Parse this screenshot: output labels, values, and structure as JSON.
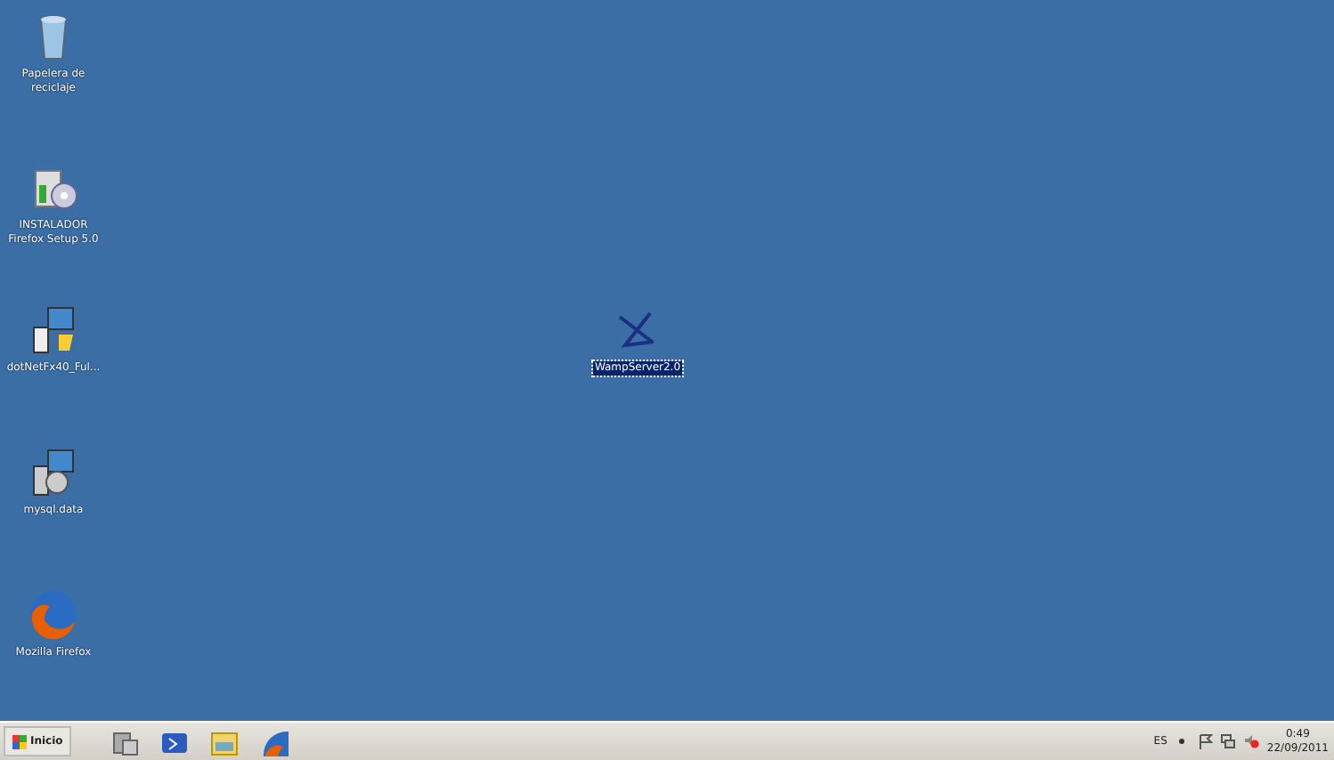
{
  "desktop_icons": [
    {
      "kind": "recycle",
      "label": "Papelera de reciclaje",
      "selected": false
    },
    {
      "kind": "installer",
      "label": "INSTALADOR Firefox Setup 5.0",
      "selected": false
    },
    {
      "kind": "setup",
      "label": "dotNetFx40_Ful...",
      "selected": false
    },
    {
      "kind": "setup2",
      "label": "mysql.data",
      "selected": false
    },
    {
      "kind": "firefox",
      "label": "Mozilla Firefox",
      "selected": false
    },
    {
      "kind": "wamp",
      "label": "WampServer2.0",
      "selected": true
    }
  ],
  "taskbar": {
    "start_label": "Inicio",
    "quick_launch": [
      {
        "kind": "server"
      },
      {
        "kind": "shell"
      },
      {
        "kind": "folder"
      },
      {
        "kind": "firefox"
      }
    ],
    "tray": {
      "language": "ES",
      "time": "0:49",
      "date": "22/09/2011"
    }
  }
}
